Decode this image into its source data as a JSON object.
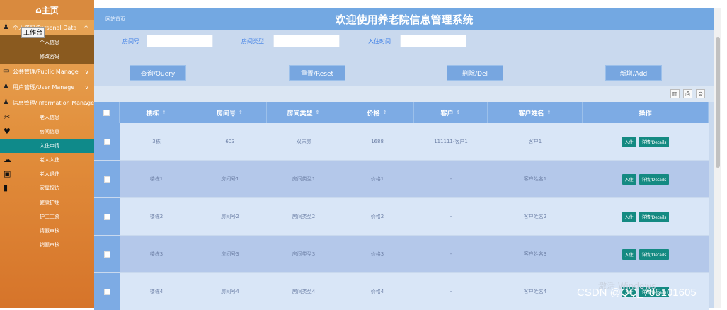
{
  "sidebar": {
    "home": "主页",
    "tooltip": "工作台",
    "groups": [
      {
        "label": "个人资料/Personal Data",
        "chev": "^"
      },
      {
        "label": "公共管理/Public Manage",
        "chev": "v"
      },
      {
        "label": "用户管理/User Manage",
        "chev": "v"
      },
      {
        "label": "信息管理/Information Manage",
        "chev": "v"
      }
    ],
    "personal_items": [
      "个人信息",
      "修改密码"
    ],
    "info_items": [
      "老人信息",
      "房间信息",
      "入住申请",
      "老人入住",
      "老人退住",
      "家属探访",
      "健康护理",
      "护工工资",
      "请假审核",
      "销假审核"
    ]
  },
  "header": {
    "breadcrumb": "网站首页",
    "title": "欢迎使用养老院信息管理系统"
  },
  "search": {
    "room_no_label": "房间号",
    "room_type_label": "房间类型",
    "checkin_time_label": "入住时间",
    "room_no_value": "",
    "room_type_value": "",
    "checkin_time_value": ""
  },
  "buttons": {
    "query": "查询/Query",
    "reset": "重置/Reset",
    "delete": "删除/Del",
    "add": "新增/Add"
  },
  "table": {
    "headers": [
      "楼栋",
      "房间号",
      "房间类型",
      "价格",
      "客户",
      "客户姓名",
      "操作"
    ],
    "sort_marker": "⇕",
    "rows": [
      {
        "building": "3栋",
        "room": "603",
        "type": "双床房",
        "price": "1688",
        "customer": "111111-客户1",
        "name": "客户1"
      },
      {
        "building": "楼栋1",
        "room": "房间号1",
        "type": "房间类型1",
        "price": "价格1",
        "customer": "-",
        "name": "客户姓名1"
      },
      {
        "building": "楼栋2",
        "room": "房间号2",
        "type": "房间类型2",
        "price": "价格2",
        "customer": "-",
        "name": "客户姓名2"
      },
      {
        "building": "楼栋3",
        "room": "房间号3",
        "type": "房间类型3",
        "price": "价格3",
        "customer": "-",
        "name": "客户姓名3"
      },
      {
        "building": "楼栋4",
        "room": "房间号4",
        "type": "房间类型4",
        "price": "价格4",
        "customer": "-",
        "name": "客户姓名4"
      }
    ],
    "action_checkin": "入住",
    "action_detail": "详情/Details"
  },
  "overlay": {
    "watermark": "激活 Windows",
    "csdn": "CSDN @QQ_785101605"
  },
  "colors": {
    "sidebar": "#e28f3c",
    "active_item": "#0f8a8a",
    "header": "#73a8e2",
    "button": "#77a6e0",
    "action_button": "#148a82"
  }
}
